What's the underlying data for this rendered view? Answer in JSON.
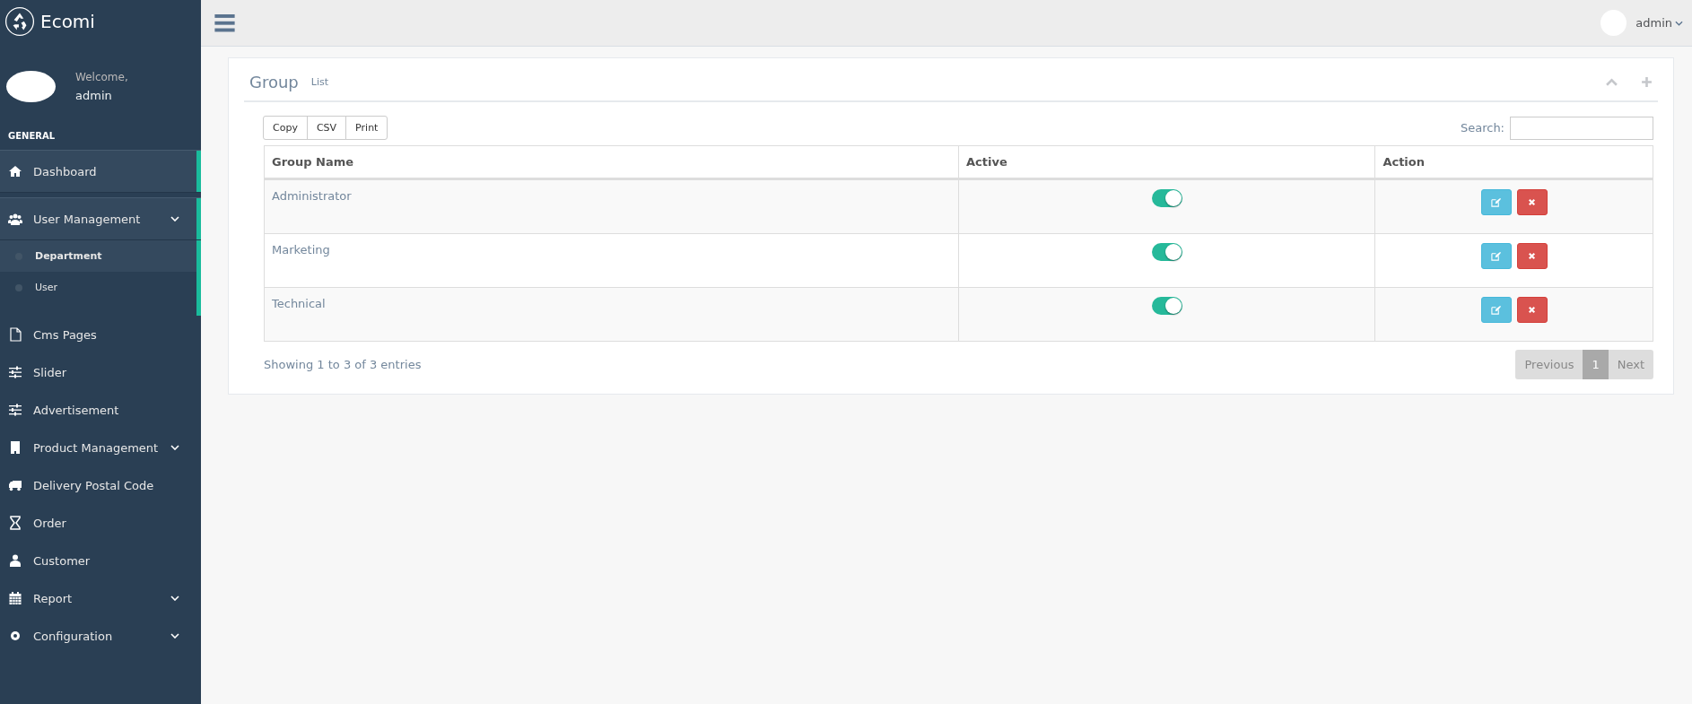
{
  "brand": "Ecomi",
  "user_panel": {
    "greeting": "Welcome,",
    "name": "admin"
  },
  "sidebar": {
    "section": "GENERAL",
    "items": [
      {
        "label": "Dashboard",
        "selected": true
      },
      {
        "label": "User Management",
        "selected": true,
        "expanded": true,
        "children": [
          {
            "label": "Department",
            "selected": true
          },
          {
            "label": "User",
            "selected": false
          }
        ]
      },
      {
        "label": "Cms Pages",
        "selected": false
      },
      {
        "label": "Slider",
        "selected": false
      },
      {
        "label": "Advertisement",
        "selected": false
      },
      {
        "label": "Product Management",
        "selected": false,
        "expanded": false
      },
      {
        "label": "Delivery Postal Code",
        "selected": false
      },
      {
        "label": "Order",
        "selected": false
      },
      {
        "label": "Customer",
        "selected": false
      },
      {
        "label": "Report",
        "selected": false,
        "expanded": false
      },
      {
        "label": "Configuration",
        "selected": false,
        "expanded": false
      }
    ]
  },
  "top_bar": {
    "user": "admin"
  },
  "panel": {
    "title": "Group",
    "subtitle": "List",
    "export_buttons": [
      "Copy",
      "CSV",
      "Print"
    ],
    "search_label": "Search:",
    "table": {
      "columns": [
        "Group Name",
        "Active",
        "Action"
      ],
      "rows": [
        {
          "name": "Administrator",
          "active": true
        },
        {
          "name": "Marketing",
          "active": true
        },
        {
          "name": "Technical",
          "active": true
        }
      ]
    },
    "info": "Showing 1 to 3 of 3 entries",
    "pagination": {
      "previous": "Previous",
      "pages": [
        {
          "label": "1",
          "selected": true
        }
      ],
      "next": "Next"
    }
  }
}
